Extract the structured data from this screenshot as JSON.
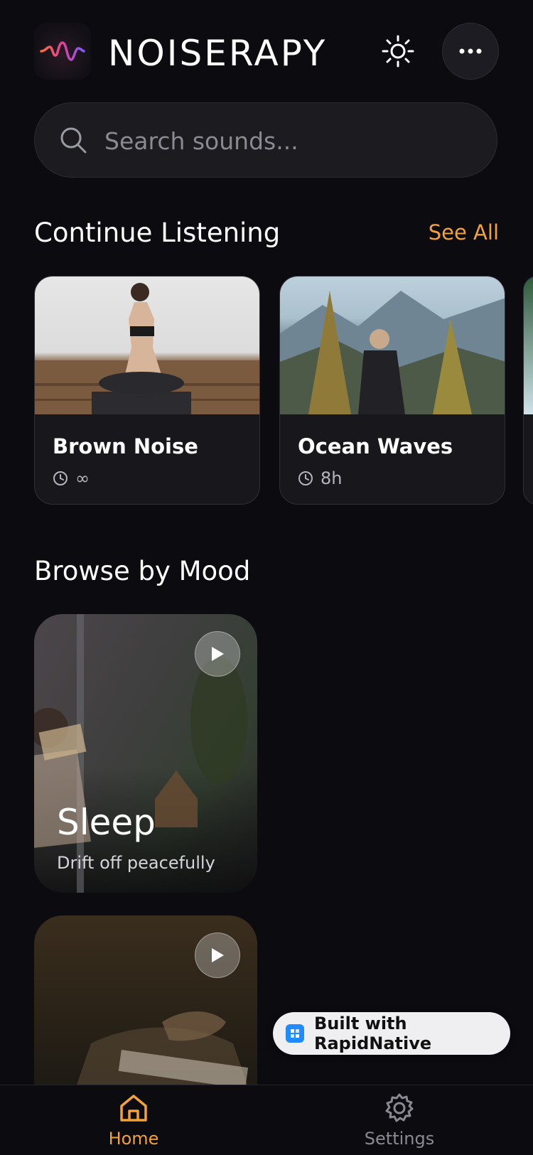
{
  "header": {
    "app_name": "NOISERAPY",
    "icons": [
      "waveform-logo",
      "sun-icon",
      "more-icon"
    ]
  },
  "search": {
    "placeholder": "Search sounds..."
  },
  "continue": {
    "title": "Continue Listening",
    "see_all": "See All",
    "cards": [
      {
        "name": "Brown Noise",
        "duration": "∞"
      },
      {
        "name": "Ocean Waves",
        "duration": "8h"
      }
    ]
  },
  "browse": {
    "title": "Browse by Mood",
    "moods": [
      {
        "title": "Sleep",
        "subtitle": "Drift off peacefully"
      },
      {
        "title": "",
        "subtitle": ""
      }
    ]
  },
  "badge": {
    "label": "Built with RapidNative"
  },
  "tabs": [
    {
      "label": "Home",
      "active": true
    },
    {
      "label": "Settings",
      "active": false
    }
  ],
  "colors": {
    "accent": "#f2a23a",
    "background": "#0b0b10",
    "card": "#17171c"
  }
}
